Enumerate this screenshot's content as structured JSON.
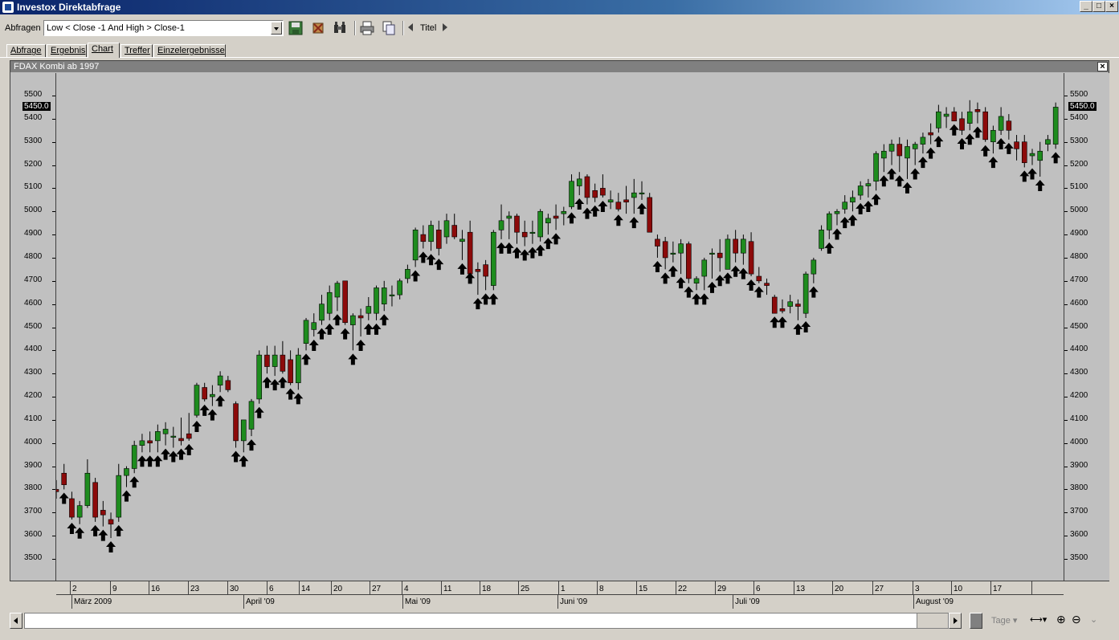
{
  "window": {
    "title": "Investox Direktabfrage"
  },
  "toolbar": {
    "query_label": "Abfragen",
    "query_value": "Low < Close -1 And High > Close-1",
    "titel_label": "Titel",
    "icons": [
      "save-icon",
      "delete-icon",
      "binoculars-icon",
      "print-icon",
      "copy-icon",
      "prev-icon",
      "next-icon"
    ]
  },
  "tabs": [
    {
      "label": "Abfrage",
      "active": false
    },
    {
      "label": "Ergebnis",
      "active": false
    },
    {
      "label": "Chart",
      "active": true
    },
    {
      "label": "Treffer",
      "active": false
    },
    {
      "label": "Einzelergebnisse",
      "active": false
    }
  ],
  "chart": {
    "title": "FDAX Kombi ab 1997",
    "last_value_label": "5450.0"
  },
  "bottom": {
    "tage_label": "Tage"
  },
  "colors": {
    "up": "#1e8c1e",
    "down": "#8c0a0a",
    "background": "#c0c0c0",
    "arrow": "#000000"
  },
  "chart_data": {
    "type": "candlestick",
    "title": "FDAX Kombi ab 1997",
    "ylim": [
      3400,
      5600
    ],
    "y_ticks": [
      3500,
      3600,
      3700,
      3800,
      3900,
      4000,
      4100,
      4200,
      4300,
      4400,
      4500,
      4600,
      4700,
      4800,
      4900,
      5000,
      5100,
      5200,
      5300,
      5400,
      5500
    ],
    "day_labels": [
      "2",
      "9",
      "16",
      "23",
      "30",
      "6",
      "14",
      "20",
      "27",
      "4",
      "11",
      "18",
      "25",
      "1",
      "8",
      "15",
      "22",
      "29",
      "6",
      "13",
      "20",
      "27",
      "3",
      "10",
      "17"
    ],
    "month_labels": [
      "März 2009",
      "April '09",
      "Mai '09",
      "Juni '09",
      "Juli '09",
      "August '09"
    ],
    "marker": "up-arrow below bar where Low < previous Close and High > previous Close",
    "candles": [
      {
        "o": 3800,
        "h": 3840,
        "l": 3760,
        "c": 3790,
        "sig": false
      },
      {
        "o": 3870,
        "h": 3910,
        "l": 3800,
        "c": 3820,
        "sig": true
      },
      {
        "o": 3760,
        "h": 3790,
        "l": 3670,
        "c": 3680,
        "sig": true
      },
      {
        "o": 3680,
        "h": 3750,
        "l": 3650,
        "c": 3730,
        "sig": true
      },
      {
        "o": 3730,
        "h": 3930,
        "l": 3720,
        "c": 3870,
        "sig": false
      },
      {
        "o": 3830,
        "h": 3850,
        "l": 3660,
        "c": 3680,
        "sig": true
      },
      {
        "o": 3710,
        "h": 3750,
        "l": 3640,
        "c": 3690,
        "sig": true
      },
      {
        "o": 3670,
        "h": 3700,
        "l": 3590,
        "c": 3650,
        "sig": true
      },
      {
        "o": 3680,
        "h": 3910,
        "l": 3660,
        "c": 3860,
        "sig": true
      },
      {
        "o": 3860,
        "h": 3900,
        "l": 3810,
        "c": 3890,
        "sig": true
      },
      {
        "o": 3890,
        "h": 4010,
        "l": 3870,
        "c": 3990,
        "sig": true
      },
      {
        "o": 3990,
        "h": 4040,
        "l": 3960,
        "c": 4010,
        "sig": true
      },
      {
        "o": 4010,
        "h": 4050,
        "l": 3960,
        "c": 4000,
        "sig": true
      },
      {
        "o": 4010,
        "h": 4080,
        "l": 3960,
        "c": 4050,
        "sig": true
      },
      {
        "o": 4040,
        "h": 4090,
        "l": 3990,
        "c": 4060,
        "sig": true
      },
      {
        "o": 4030,
        "h": 4070,
        "l": 3980,
        "c": 4030,
        "sig": true
      },
      {
        "o": 4020,
        "h": 4110,
        "l": 3990,
        "c": 4010,
        "sig": true
      },
      {
        "o": 4040,
        "h": 4130,
        "l": 4010,
        "c": 4020,
        "sig": true
      },
      {
        "o": 4120,
        "h": 4260,
        "l": 4110,
        "c": 4250,
        "sig": true
      },
      {
        "o": 4240,
        "h": 4260,
        "l": 4180,
        "c": 4190,
        "sig": true
      },
      {
        "o": 4200,
        "h": 4250,
        "l": 4160,
        "c": 4210,
        "sig": true
      },
      {
        "o": 4250,
        "h": 4310,
        "l": 4220,
        "c": 4290,
        "sig": true
      },
      {
        "o": 4270,
        "h": 4290,
        "l": 4220,
        "c": 4230,
        "sig": false
      },
      {
        "o": 4170,
        "h": 4180,
        "l": 3980,
        "c": 4010,
        "sig": true
      },
      {
        "o": 4010,
        "h": 4100,
        "l": 3960,
        "c": 4100,
        "sig": true
      },
      {
        "o": 4060,
        "h": 4190,
        "l": 4030,
        "c": 4180,
        "sig": true
      },
      {
        "o": 4190,
        "h": 4400,
        "l": 4170,
        "c": 4380,
        "sig": true
      },
      {
        "o": 4380,
        "h": 4420,
        "l": 4300,
        "c": 4330,
        "sig": true
      },
      {
        "o": 4330,
        "h": 4420,
        "l": 4290,
        "c": 4380,
        "sig": true
      },
      {
        "o": 4380,
        "h": 4440,
        "l": 4300,
        "c": 4310,
        "sig": true
      },
      {
        "o": 4360,
        "h": 4400,
        "l": 4250,
        "c": 4260,
        "sig": true
      },
      {
        "o": 4260,
        "h": 4410,
        "l": 4230,
        "c": 4380,
        "sig": true
      },
      {
        "o": 4430,
        "h": 4540,
        "l": 4400,
        "c": 4530,
        "sig": true
      },
      {
        "o": 4490,
        "h": 4560,
        "l": 4460,
        "c": 4520,
        "sig": true
      },
      {
        "o": 4530,
        "h": 4640,
        "l": 4510,
        "c": 4600,
        "sig": true
      },
      {
        "o": 4560,
        "h": 4680,
        "l": 4530,
        "c": 4650,
        "sig": true
      },
      {
        "o": 4630,
        "h": 4700,
        "l": 4570,
        "c": 4690,
        "sig": true
      },
      {
        "o": 4700,
        "h": 4700,
        "l": 4510,
        "c": 4520,
        "sig": true
      },
      {
        "o": 4510,
        "h": 4560,
        "l": 4400,
        "c": 4550,
        "sig": true
      },
      {
        "o": 4550,
        "h": 4580,
        "l": 4460,
        "c": 4540,
        "sig": true
      },
      {
        "o": 4560,
        "h": 4630,
        "l": 4530,
        "c": 4590,
        "sig": true
      },
      {
        "o": 4560,
        "h": 4680,
        "l": 4530,
        "c": 4670,
        "sig": true
      },
      {
        "o": 4600,
        "h": 4700,
        "l": 4570,
        "c": 4670,
        "sig": true
      },
      {
        "o": 4640,
        "h": 4680,
        "l": 4590,
        "c": 4640,
        "sig": false
      },
      {
        "o": 4640,
        "h": 4710,
        "l": 4620,
        "c": 4700,
        "sig": false
      },
      {
        "o": 4710,
        "h": 4770,
        "l": 4690,
        "c": 4750,
        "sig": false
      },
      {
        "o": 4790,
        "h": 4930,
        "l": 4760,
        "c": 4920,
        "sig": true
      },
      {
        "o": 4900,
        "h": 4940,
        "l": 4840,
        "c": 4870,
        "sig": true
      },
      {
        "o": 4870,
        "h": 4960,
        "l": 4830,
        "c": 4940,
        "sig": true
      },
      {
        "o": 4920,
        "h": 4960,
        "l": 4810,
        "c": 4840,
        "sig": true
      },
      {
        "o": 4890,
        "h": 4990,
        "l": 4860,
        "c": 4960,
        "sig": false
      },
      {
        "o": 4940,
        "h": 4990,
        "l": 4880,
        "c": 4890,
        "sig": false
      },
      {
        "o": 4870,
        "h": 4920,
        "l": 4790,
        "c": 4880,
        "sig": true
      },
      {
        "o": 4910,
        "h": 4960,
        "l": 4750,
        "c": 4730,
        "sig": true
      },
      {
        "o": 4750,
        "h": 4780,
        "l": 4640,
        "c": 4740,
        "sig": true
      },
      {
        "o": 4770,
        "h": 4790,
        "l": 4660,
        "c": 4720,
        "sig": true
      },
      {
        "o": 4680,
        "h": 4920,
        "l": 4660,
        "c": 4910,
        "sig": true
      },
      {
        "o": 4920,
        "h": 5030,
        "l": 4880,
        "c": 4960,
        "sig": true
      },
      {
        "o": 4970,
        "h": 5000,
        "l": 4880,
        "c": 4980,
        "sig": true
      },
      {
        "o": 4980,
        "h": 4990,
        "l": 4860,
        "c": 4910,
        "sig": true
      },
      {
        "o": 4910,
        "h": 4960,
        "l": 4850,
        "c": 4890,
        "sig": true
      },
      {
        "o": 4910,
        "h": 4960,
        "l": 4860,
        "c": 4910,
        "sig": true
      },
      {
        "o": 4890,
        "h": 5010,
        "l": 4870,
        "c": 5000,
        "sig": true
      },
      {
        "o": 4950,
        "h": 4990,
        "l": 4900,
        "c": 4970,
        "sig": true
      },
      {
        "o": 4980,
        "h": 5030,
        "l": 4920,
        "c": 4970,
        "sig": true
      },
      {
        "o": 4990,
        "h": 5020,
        "l": 4940,
        "c": 5000,
        "sig": false
      },
      {
        "o": 5020,
        "h": 5160,
        "l": 5010,
        "c": 5130,
        "sig": true
      },
      {
        "o": 5110,
        "h": 5170,
        "l": 5070,
        "c": 5140,
        "sig": true
      },
      {
        "o": 5150,
        "h": 5160,
        "l": 5030,
        "c": 5060,
        "sig": true
      },
      {
        "o": 5090,
        "h": 5120,
        "l": 5040,
        "c": 5060,
        "sig": true
      },
      {
        "o": 5100,
        "h": 5160,
        "l": 5060,
        "c": 5070,
        "sig": true
      },
      {
        "o": 5040,
        "h": 5090,
        "l": 5010,
        "c": 5050,
        "sig": false
      },
      {
        "o": 5040,
        "h": 5080,
        "l": 5000,
        "c": 5010,
        "sig": true
      },
      {
        "o": 5050,
        "h": 5110,
        "l": 4990,
        "c": 5040,
        "sig": false
      },
      {
        "o": 5060,
        "h": 5140,
        "l": 4990,
        "c": 5080,
        "sig": true
      },
      {
        "o": 5080,
        "h": 5130,
        "l": 5050,
        "c": 5080,
        "sig": true
      },
      {
        "o": 5060,
        "h": 5080,
        "l": 4920,
        "c": 4910,
        "sig": false
      },
      {
        "o": 4880,
        "h": 4900,
        "l": 4800,
        "c": 4850,
        "sig": true
      },
      {
        "o": 4870,
        "h": 4890,
        "l": 4750,
        "c": 4800,
        "sig": true
      },
      {
        "o": 4820,
        "h": 4870,
        "l": 4780,
        "c": 4820,
        "sig": true
      },
      {
        "o": 4820,
        "h": 4880,
        "l": 4730,
        "c": 4860,
        "sig": true
      },
      {
        "o": 4860,
        "h": 4870,
        "l": 4690,
        "c": 4710,
        "sig": true
      },
      {
        "o": 4690,
        "h": 4720,
        "l": 4660,
        "c": 4710,
        "sig": true
      },
      {
        "o": 4720,
        "h": 4800,
        "l": 4660,
        "c": 4790,
        "sig": true
      },
      {
        "o": 4820,
        "h": 4840,
        "l": 4710,
        "c": 4820,
        "sig": true
      },
      {
        "o": 4820,
        "h": 4880,
        "l": 4740,
        "c": 4800,
        "sig": true
      },
      {
        "o": 4750,
        "h": 4900,
        "l": 4750,
        "c": 4880,
        "sig": true
      },
      {
        "o": 4880,
        "h": 4920,
        "l": 4780,
        "c": 4820,
        "sig": true
      },
      {
        "o": 4820,
        "h": 4900,
        "l": 4770,
        "c": 4880,
        "sig": true
      },
      {
        "o": 4870,
        "h": 4910,
        "l": 4720,
        "c": 4730,
        "sig": true
      },
      {
        "o": 4720,
        "h": 4760,
        "l": 4690,
        "c": 4700,
        "sig": true
      },
      {
        "o": 4690,
        "h": 4710,
        "l": 4640,
        "c": 4680,
        "sig": false
      },
      {
        "o": 4630,
        "h": 4640,
        "l": 4560,
        "c": 4560,
        "sig": true
      },
      {
        "o": 4580,
        "h": 4620,
        "l": 4560,
        "c": 4570,
        "sig": true
      },
      {
        "o": 4590,
        "h": 4640,
        "l": 4560,
        "c": 4610,
        "sig": false
      },
      {
        "o": 4600,
        "h": 4620,
        "l": 4530,
        "c": 4590,
        "sig": true
      },
      {
        "o": 4560,
        "h": 4740,
        "l": 4540,
        "c": 4730,
        "sig": true
      },
      {
        "o": 4730,
        "h": 4800,
        "l": 4690,
        "c": 4790,
        "sig": true
      },
      {
        "o": 4840,
        "h": 4940,
        "l": 4830,
        "c": 4920,
        "sig": false
      },
      {
        "o": 4920,
        "h": 5000,
        "l": 4880,
        "c": 4990,
        "sig": true
      },
      {
        "o": 4990,
        "h": 5010,
        "l": 4940,
        "c": 5000,
        "sig": true
      },
      {
        "o": 5010,
        "h": 5070,
        "l": 4990,
        "c": 5040,
        "sig": true
      },
      {
        "o": 5040,
        "h": 5090,
        "l": 5000,
        "c": 5060,
        "sig": true
      },
      {
        "o": 5070,
        "h": 5130,
        "l": 5050,
        "c": 5110,
        "sig": true
      },
      {
        "o": 5110,
        "h": 5140,
        "l": 5060,
        "c": 5120,
        "sig": true
      },
      {
        "o": 5130,
        "h": 5260,
        "l": 5090,
        "c": 5250,
        "sig": true
      },
      {
        "o": 5230,
        "h": 5290,
        "l": 5170,
        "c": 5260,
        "sig": true
      },
      {
        "o": 5260,
        "h": 5310,
        "l": 5200,
        "c": 5290,
        "sig": true
      },
      {
        "o": 5290,
        "h": 5320,
        "l": 5170,
        "c": 5240,
        "sig": true
      },
      {
        "o": 5230,
        "h": 5310,
        "l": 5140,
        "c": 5280,
        "sig": true
      },
      {
        "o": 5270,
        "h": 5300,
        "l": 5200,
        "c": 5290,
        "sig": true
      },
      {
        "o": 5290,
        "h": 5340,
        "l": 5250,
        "c": 5320,
        "sig": true
      },
      {
        "o": 5340,
        "h": 5380,
        "l": 5290,
        "c": 5330,
        "sig": true
      },
      {
        "o": 5360,
        "h": 5460,
        "l": 5340,
        "c": 5430,
        "sig": true
      },
      {
        "o": 5410,
        "h": 5450,
        "l": 5360,
        "c": 5420,
        "sig": false
      },
      {
        "o": 5430,
        "h": 5450,
        "l": 5390,
        "c": 5390,
        "sig": true
      },
      {
        "o": 5400,
        "h": 5430,
        "l": 5330,
        "c": 5350,
        "sig": true
      },
      {
        "o": 5380,
        "h": 5480,
        "l": 5350,
        "c": 5430,
        "sig": true
      },
      {
        "o": 5440,
        "h": 5470,
        "l": 5380,
        "c": 5430,
        "sig": true
      },
      {
        "o": 5430,
        "h": 5450,
        "l": 5300,
        "c": 5310,
        "sig": true
      },
      {
        "o": 5300,
        "h": 5370,
        "l": 5250,
        "c": 5350,
        "sig": true
      },
      {
        "o": 5350,
        "h": 5450,
        "l": 5330,
        "c": 5410,
        "sig": true
      },
      {
        "o": 5390,
        "h": 5420,
        "l": 5310,
        "c": 5350,
        "sig": true
      },
      {
        "o": 5300,
        "h": 5330,
        "l": 5220,
        "c": 5270,
        "sig": false
      },
      {
        "o": 5300,
        "h": 5330,
        "l": 5190,
        "c": 5210,
        "sig": true
      },
      {
        "o": 5240,
        "h": 5270,
        "l": 5200,
        "c": 5250,
        "sig": true
      },
      {
        "o": 5220,
        "h": 5300,
        "l": 5150,
        "c": 5260,
        "sig": true
      },
      {
        "o": 5290,
        "h": 5330,
        "l": 5260,
        "c": 5310,
        "sig": false
      },
      {
        "o": 5290,
        "h": 5470,
        "l": 5270,
        "c": 5450,
        "sig": true
      }
    ]
  }
}
